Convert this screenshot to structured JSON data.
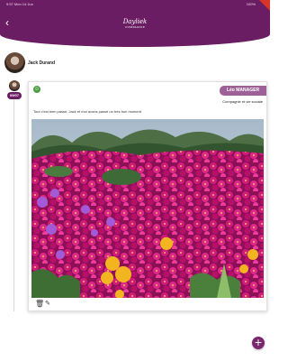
{
  "status_bar": {
    "left": "9:57 Mon 14 Jun",
    "right": "100%"
  },
  "header": {
    "logo_text": "Dayliek",
    "logo_tagline": "COMPAGNIE"
  },
  "profile": {
    "name": "Jack Durand"
  },
  "timeline": {
    "date": "09/07"
  },
  "post": {
    "author": "Léo MANAGER",
    "category": "Compagnie et vie sociale",
    "message": "Tout c'est bien passé, Jack et moi avons passé un très bon moment"
  },
  "icons": {
    "back": "chevron-left-icon",
    "mood": "smiley-icon",
    "trash": "trash-icon",
    "pencil": "pencil-icon",
    "add": "plus-icon"
  },
  "colors": {
    "brand": "#6b1d63",
    "badge": "#9d6197",
    "mood": "#4a9e3f"
  }
}
